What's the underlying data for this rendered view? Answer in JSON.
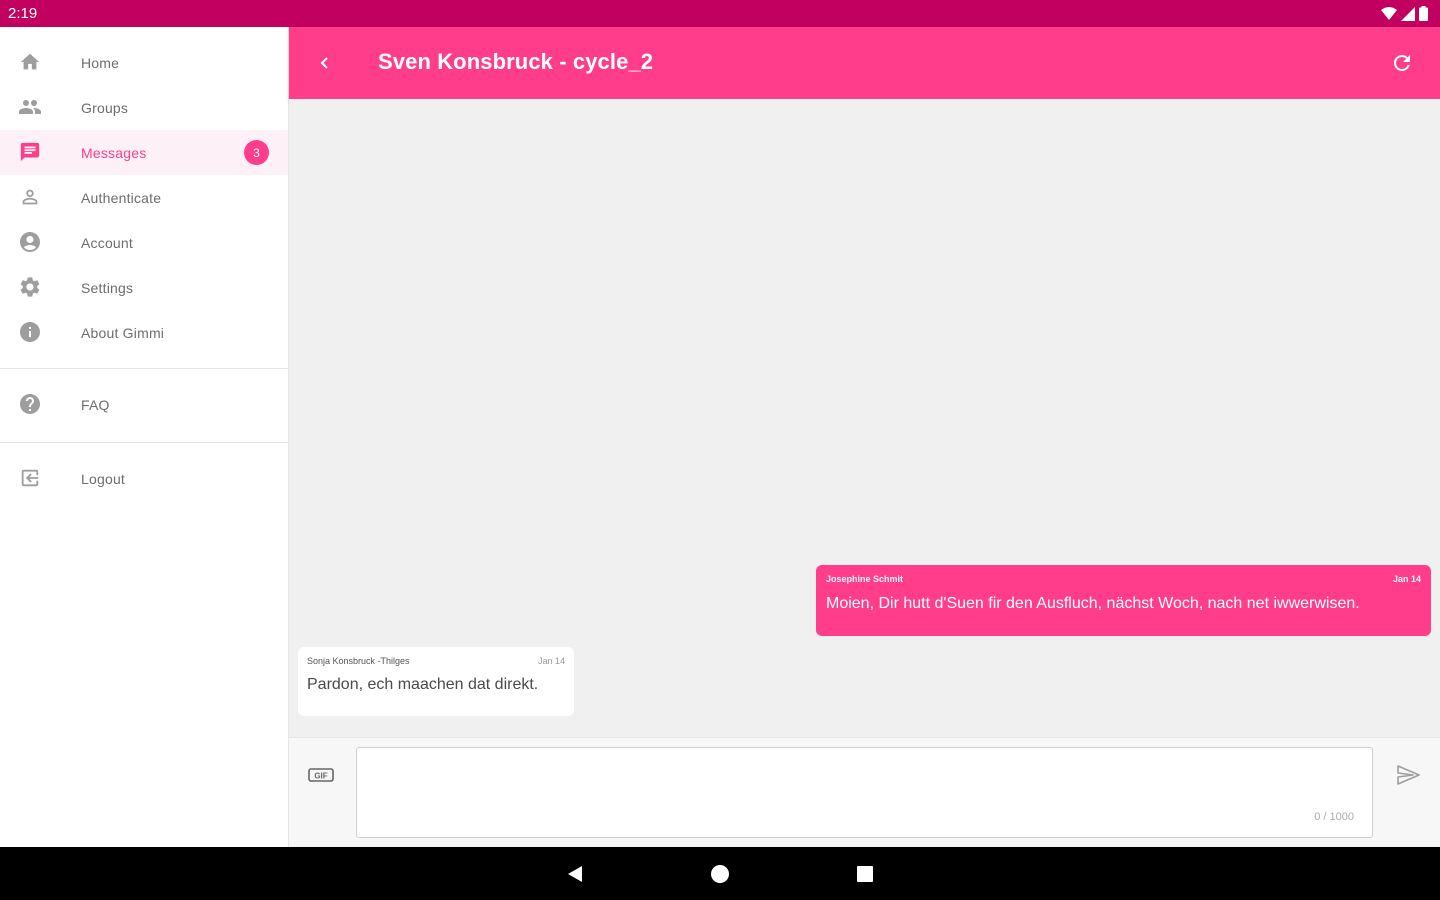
{
  "status_bar": {
    "time": "2:19"
  },
  "sidebar": {
    "items": [
      {
        "label": "Home",
        "icon": "home-icon"
      },
      {
        "label": "Groups",
        "icon": "people-icon"
      },
      {
        "label": "Messages",
        "icon": "chat-icon",
        "badge": "3",
        "active": true
      },
      {
        "label": "Authenticate",
        "icon": "person-outline-icon"
      },
      {
        "label": "Account",
        "icon": "account-circle-icon"
      },
      {
        "label": "Settings",
        "icon": "gear-icon"
      },
      {
        "label": "About Gimmi",
        "icon": "info-icon"
      }
    ],
    "faq_label": "FAQ",
    "logout_label": "Logout"
  },
  "toolbar": {
    "title": "Sven Konsbruck - cycle_2"
  },
  "messages": [
    {
      "direction": "outgoing",
      "sender": "Josephine Schmit",
      "date": "Jan 14",
      "text": "Moien, Dir hutt d'Suen fir den Ausfluch, nächst Woch, nach net iwwerwisen."
    },
    {
      "direction": "incoming",
      "sender": "Sonja Konsbruck -Thilges",
      "date": "Jan 14",
      "text": "Pardon, ech maachen dat direkt."
    }
  ],
  "composer": {
    "gif_label": "GIF",
    "value": "",
    "counter": "0 / 1000"
  },
  "colors": {
    "accent": "#ff3d8a",
    "status_bar": "#c2005f",
    "background": "#f0f0f0"
  }
}
